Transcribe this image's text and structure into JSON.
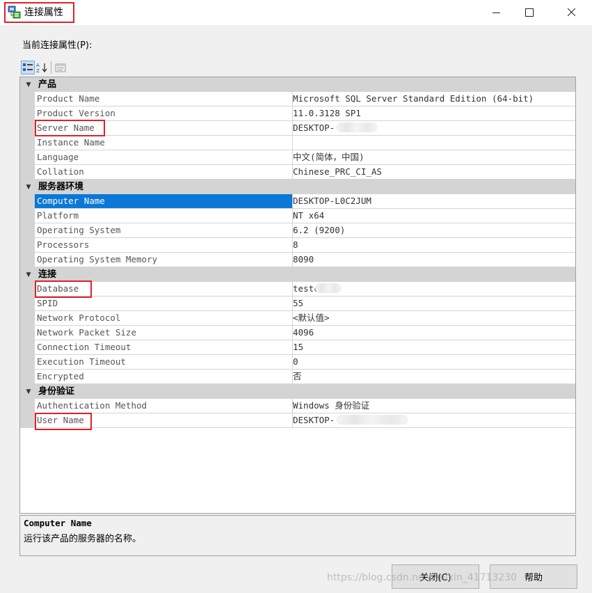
{
  "window": {
    "title": "连接属性",
    "icons": {
      "app": "server-connection-icon",
      "minimize": "minimize-icon",
      "maximize": "maximize-icon",
      "close": "close-icon"
    }
  },
  "current_props_label": "当前连接属性(P):",
  "toolbar": {
    "categorized_icon": "categorized-view-icon",
    "alphabetical_icon": "sort-alphabetical-icon",
    "property_pages_icon": "property-pages-icon"
  },
  "grid": {
    "categories": [
      {
        "name": "产品",
        "rows": [
          {
            "name": "Product Name",
            "value": "Microsoft SQL Server Standard Edition (64-bit)"
          },
          {
            "name": "Product Version",
            "value": "11.0.3128 SP1"
          },
          {
            "name": "Server Name",
            "value": "DESKTOP-"
          },
          {
            "name": "Instance Name",
            "value": ""
          },
          {
            "name": "Language",
            "value": "中文(简体，中国)"
          },
          {
            "name": "Collation",
            "value": "Chinese_PRC_CI_AS"
          }
        ]
      },
      {
        "name": "服务器环境",
        "rows": [
          {
            "name": "Computer Name",
            "value": "DESKTOP-L0C2JUM"
          },
          {
            "name": "Platform",
            "value": "NT x64"
          },
          {
            "name": "Operating System",
            "value": "6.2 (9200)"
          },
          {
            "name": "Processors",
            "value": "8"
          },
          {
            "name": "Operating System Memory",
            "value": "8090"
          }
        ]
      },
      {
        "name": "连接",
        "rows": [
          {
            "name": "Database",
            "value": "testc"
          },
          {
            "name": "SPID",
            "value": "55"
          },
          {
            "name": "Network Protocol",
            "value": "<默认值>"
          },
          {
            "name": "Network Packet Size",
            "value": "4096"
          },
          {
            "name": "Connection Timeout",
            "value": "15"
          },
          {
            "name": "Execution Timeout",
            "value": "0"
          },
          {
            "name": "Encrypted",
            "value": "否"
          }
        ]
      },
      {
        "name": "身份验证",
        "rows": [
          {
            "name": "Authentication Method",
            "value": "Windows 身份验证"
          },
          {
            "name": "User Name",
            "value": "DESKTOP-"
          }
        ]
      }
    ]
  },
  "description": {
    "title": "Computer Name",
    "text": "运行该产品的服务器的名称。"
  },
  "buttons": {
    "close": "关闭(C)",
    "help": "帮助"
  },
  "watermark": "https://blog.csdn.net/weixin_41713230"
}
